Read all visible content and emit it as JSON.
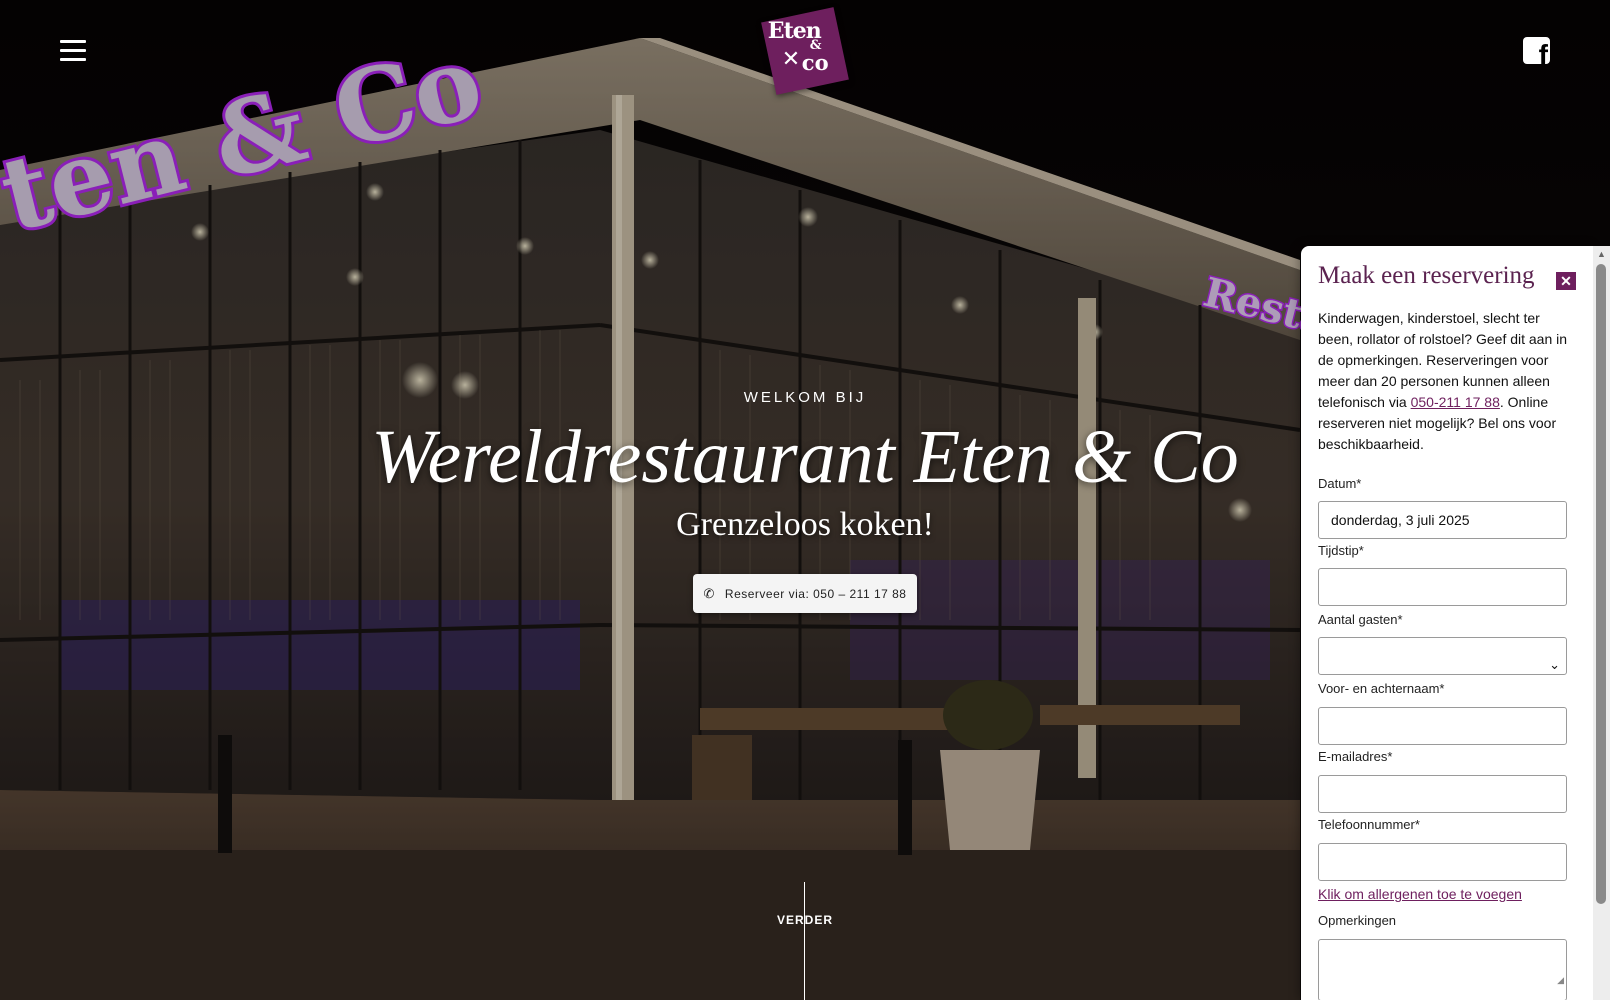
{
  "header": {
    "logo_line1": "Eten",
    "logo_amp": "&",
    "logo_line2": "co",
    "menu_icon": "hamburger-menu-icon",
    "social_icon": "facebook-icon",
    "social_glyph": "f"
  },
  "hero": {
    "background_sign": "ten & Co",
    "side_sign": "Restau",
    "welcome": "WELKOM BIJ",
    "title": "Wereldrestaurant Eten & Co",
    "subtitle": "Grenzeloos koken!",
    "reserve_button": "Reserveer via: 050 – 211 17 88",
    "reserve_icon": "phone-icon",
    "scroll_label": "VERDER"
  },
  "reservation": {
    "title": "Maak een reservering",
    "close_icon": "close-icon",
    "intro_before": "Kinderwagen, kinderstoel, slecht ter been, rollator of rolstoel? Geef dit aan in de opmerkingen. Reserveringen voor meer dan 20 personen kunnen alleen telefonisch via ",
    "intro_phone": "050-211 17 88",
    "intro_after": ". Online reserveren niet mogelijk? Bel ons voor beschikbaarheid.",
    "fields": {
      "date_label": "Datum*",
      "date_value": "donderdag, 3 juli 2025",
      "time_label": "Tijdstip*",
      "time_value": "",
      "guests_label": "Aantal gasten*",
      "guests_value": "",
      "name_label": "Voor- en achternaam*",
      "name_value": "",
      "email_label": "E-mailadres*",
      "email_value": "",
      "phone_label": "Telefoonnummer*",
      "phone_value": "",
      "allergen_link": "Klik om allergenen toe te voegen",
      "remarks_label": "Opmerkingen",
      "remarks_value": ""
    }
  },
  "colors": {
    "brand_purple": "#6e1f5e",
    "title_purple": "#5b2350",
    "neon_pink": "#d23cff"
  }
}
